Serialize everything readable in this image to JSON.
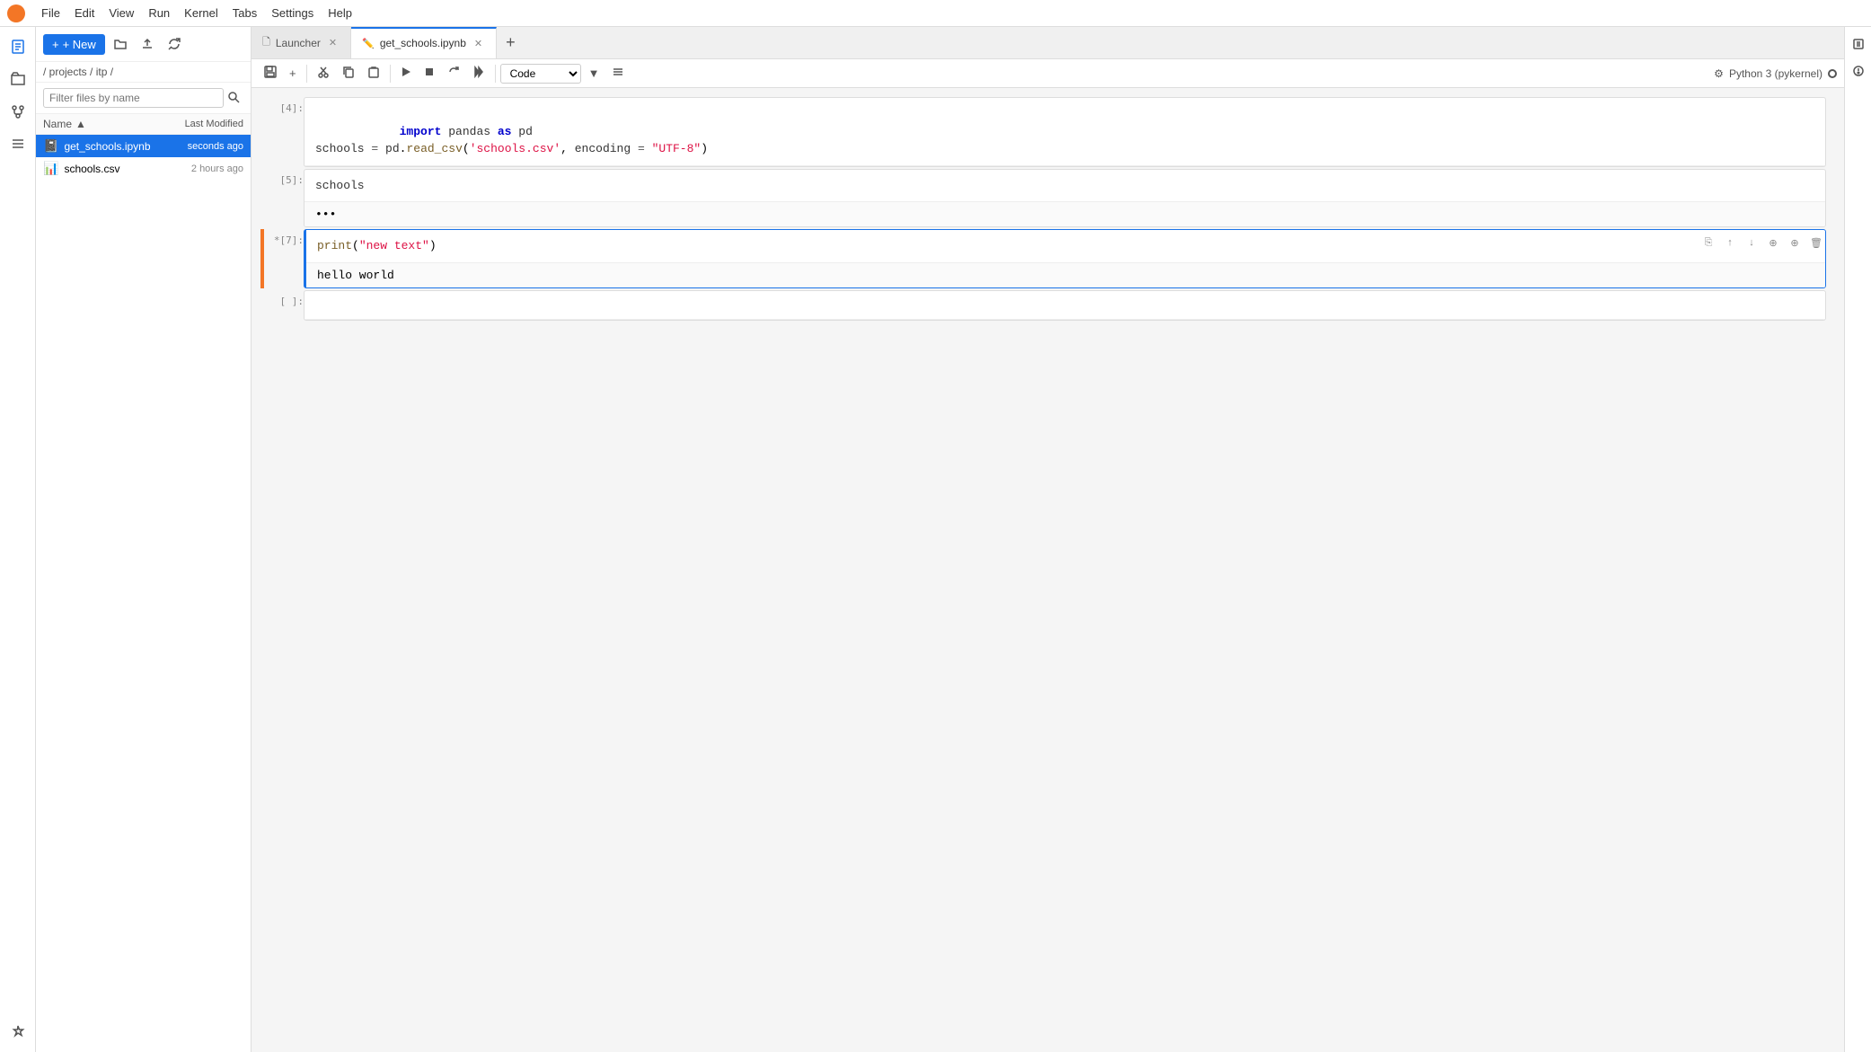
{
  "menubar": {
    "items": [
      "File",
      "Edit",
      "View",
      "Run",
      "Kernel",
      "Tabs",
      "Settings",
      "Help"
    ]
  },
  "sidebar": {
    "new_label": "+ New",
    "breadcrumb": "/ projects / itp /",
    "filter_placeholder": "Filter files by name",
    "columns": {
      "name": "Name",
      "modified": "Last Modified"
    },
    "files": [
      {
        "name": "get_schools.ipynb",
        "type": "notebook",
        "modified": "seconds ago",
        "selected": true
      },
      {
        "name": "schools.csv",
        "type": "csv",
        "modified": "2 hours ago",
        "selected": false
      }
    ]
  },
  "tabs": [
    {
      "id": "launcher",
      "label": "Launcher",
      "icon": "🗋",
      "active": false,
      "closeable": true
    },
    {
      "id": "notebook",
      "label": "get_schools.ipynb",
      "icon": "📓",
      "active": true,
      "closeable": true
    }
  ],
  "notebook": {
    "kernel": "Python 3 (pykernel)",
    "toolbar": {
      "save": "💾",
      "add_cell": "+",
      "cut": "✂",
      "copy": "⎘",
      "paste": "📋",
      "run": "▶",
      "stop": "■",
      "restart": "↺",
      "fastforward": "⏭",
      "cell_type": "Code"
    },
    "cells": [
      {
        "id": "cell1",
        "number": "[4]:",
        "running": false,
        "selected": false,
        "input_lines": [
          "import pandas as pd",
          "schools = pd.read_csv('schools.csv', encoding = \"UTF-8\")"
        ],
        "output": null
      },
      {
        "id": "cell2",
        "number": "[5]:",
        "running": false,
        "selected": false,
        "input_lines": [
          "schools"
        ],
        "output": "•••"
      },
      {
        "id": "cell3",
        "number": "*[7]:",
        "running": true,
        "selected": true,
        "input_lines": [
          "print(\"new text\")"
        ],
        "output": "hello world"
      },
      {
        "id": "cell4",
        "number": "[ ]:",
        "running": false,
        "selected": false,
        "input_lines": [
          ""
        ],
        "output": null
      }
    ]
  }
}
